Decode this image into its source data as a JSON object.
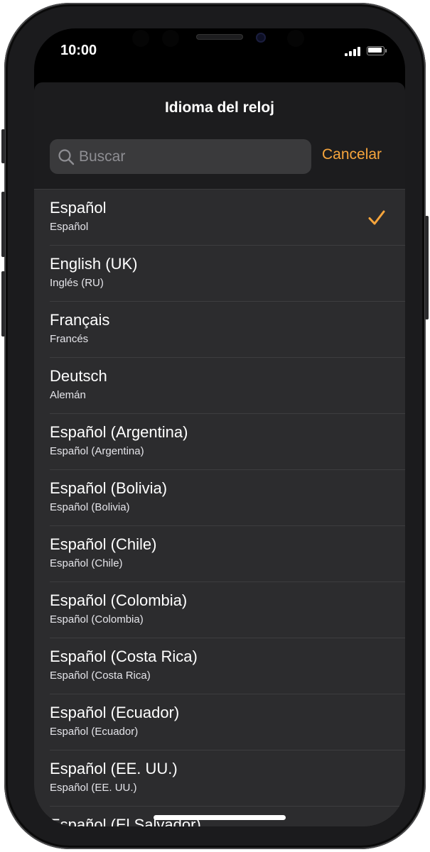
{
  "status_bar": {
    "time": "10:00"
  },
  "sheet": {
    "title": "Idioma del reloj",
    "search": {
      "placeholder": "Buscar",
      "value": ""
    },
    "cancel_label": "Cancelar"
  },
  "colors": {
    "accent": "#f7a53c",
    "sheet_background": "#1c1c1e",
    "list_background": "#2c2c2e"
  },
  "selected_language": "Español",
  "languages": [
    {
      "name": "Español",
      "native": "Español"
    },
    {
      "name": "English (UK)",
      "native": "Inglés (RU)"
    },
    {
      "name": "Français",
      "native": "Francés"
    },
    {
      "name": "Deutsch",
      "native": "Alemán"
    },
    {
      "name": "Español (Argentina)",
      "native": "Español (Argentina)"
    },
    {
      "name": "Español (Bolivia)",
      "native": "Español (Bolivia)"
    },
    {
      "name": "Español (Chile)",
      "native": "Español (Chile)"
    },
    {
      "name": "Español (Colombia)",
      "native": "Español (Colombia)"
    },
    {
      "name": "Español (Costa Rica)",
      "native": "Español (Costa Rica)"
    },
    {
      "name": "Español (Ecuador)",
      "native": "Español (Ecuador)"
    },
    {
      "name": "Español (EE. UU.)",
      "native": "Español (EE. UU.)"
    },
    {
      "name": "Español (El Salvador)",
      "native": ""
    }
  ]
}
